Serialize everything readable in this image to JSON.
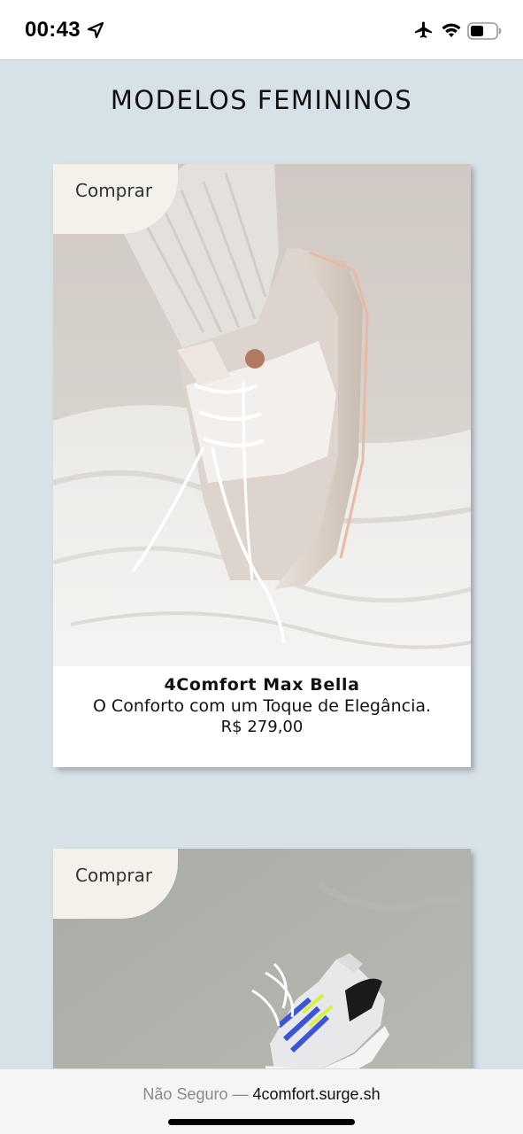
{
  "status_bar": {
    "time": "00:43",
    "icons": [
      "location-arrow-icon",
      "airplane-icon",
      "wifi-icon",
      "battery-icon"
    ]
  },
  "page": {
    "title": "MODELOS FEMININOS"
  },
  "products": [
    {
      "buy_label": "Comprar",
      "name": "4Comfort Max Bella",
      "description": "O Conforto com um Toque de Elegância.",
      "price": "R$ 279,00"
    },
    {
      "buy_label": "Comprar"
    }
  ],
  "browser_bar": {
    "security": "Não Seguro —",
    "domain": "4comfort.surge.sh"
  },
  "colors": {
    "page_background": "#d7e2e8",
    "badge_background": "#f4f1ea"
  }
}
